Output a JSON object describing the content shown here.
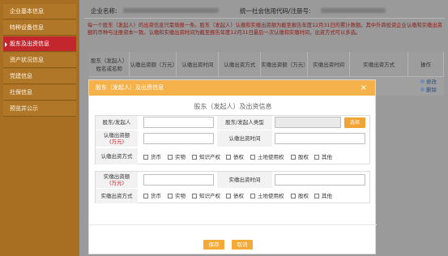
{
  "sidebar": {
    "items": [
      {
        "label": "企业基本信息",
        "active": false
      },
      {
        "label": "特种设备信息",
        "active": false
      },
      {
        "label": "股东及出资信息",
        "active": true
      },
      {
        "label": "资产状况信息",
        "active": false
      },
      {
        "label": "党建信息",
        "active": false
      },
      {
        "label": "社保信息",
        "active": false
      },
      {
        "label": "预览并公示",
        "active": false
      }
    ]
  },
  "info_bar": {
    "company_name_label": "企业名称:",
    "credit_code_label": "统一社会信用代码/注册号:"
  },
  "notice": "每一个股东（发起人）的出资信息只需填报一条。股东（发起人）认缴和实缴出资额为截至报告年度12月31日的累计数额。其中外商投资企业认缴和实缴出资额的币种与注册资本一致。认缴和实缴出资时间为截至报告年度12月31日最后一次认缴和实缴时间，出资方式可以多选。",
  "table": {
    "headers": [
      "股东（发起人）姓名或名称",
      "认缴出资额（万元）",
      "认缴出资时间",
      "认缴出资方式",
      "实缴出资额（万元）",
      "实缴出资时间",
      "实缴出资方式",
      "操作"
    ],
    "row_actions": [
      "修改",
      "删除"
    ]
  },
  "modal": {
    "header": "股东（发起人）及出资信息",
    "close_icon": "×",
    "title": "股东（发起人）及出资信息",
    "fields": {
      "shareholder_label": "股东/发起人",
      "shareholder_type_label": "股东/发起人类型",
      "select_button": "选择",
      "subscribed_amount_label": "认缴出资额",
      "unit": "(万元)",
      "subscribed_time_label": "认缴出资时间",
      "subscribed_method_label": "认缴出资方式",
      "paid_amount_label": "实缴出资额",
      "paid_time_label": "实缴出资时间",
      "paid_method_label": "实缴出资方式"
    },
    "methods": [
      "货币",
      "实物",
      "知识产权",
      "债权",
      "土地使用权",
      "股权",
      "其他"
    ],
    "buttons": {
      "save": "保存",
      "cancel": "取消"
    }
  },
  "colors": {
    "sidebar": "#a86f22",
    "active_item": "#c4262e",
    "modal_header": "#f5b24b",
    "button": "#f5a936",
    "notice_text": "#8a1a16",
    "required": "#c8161d"
  }
}
